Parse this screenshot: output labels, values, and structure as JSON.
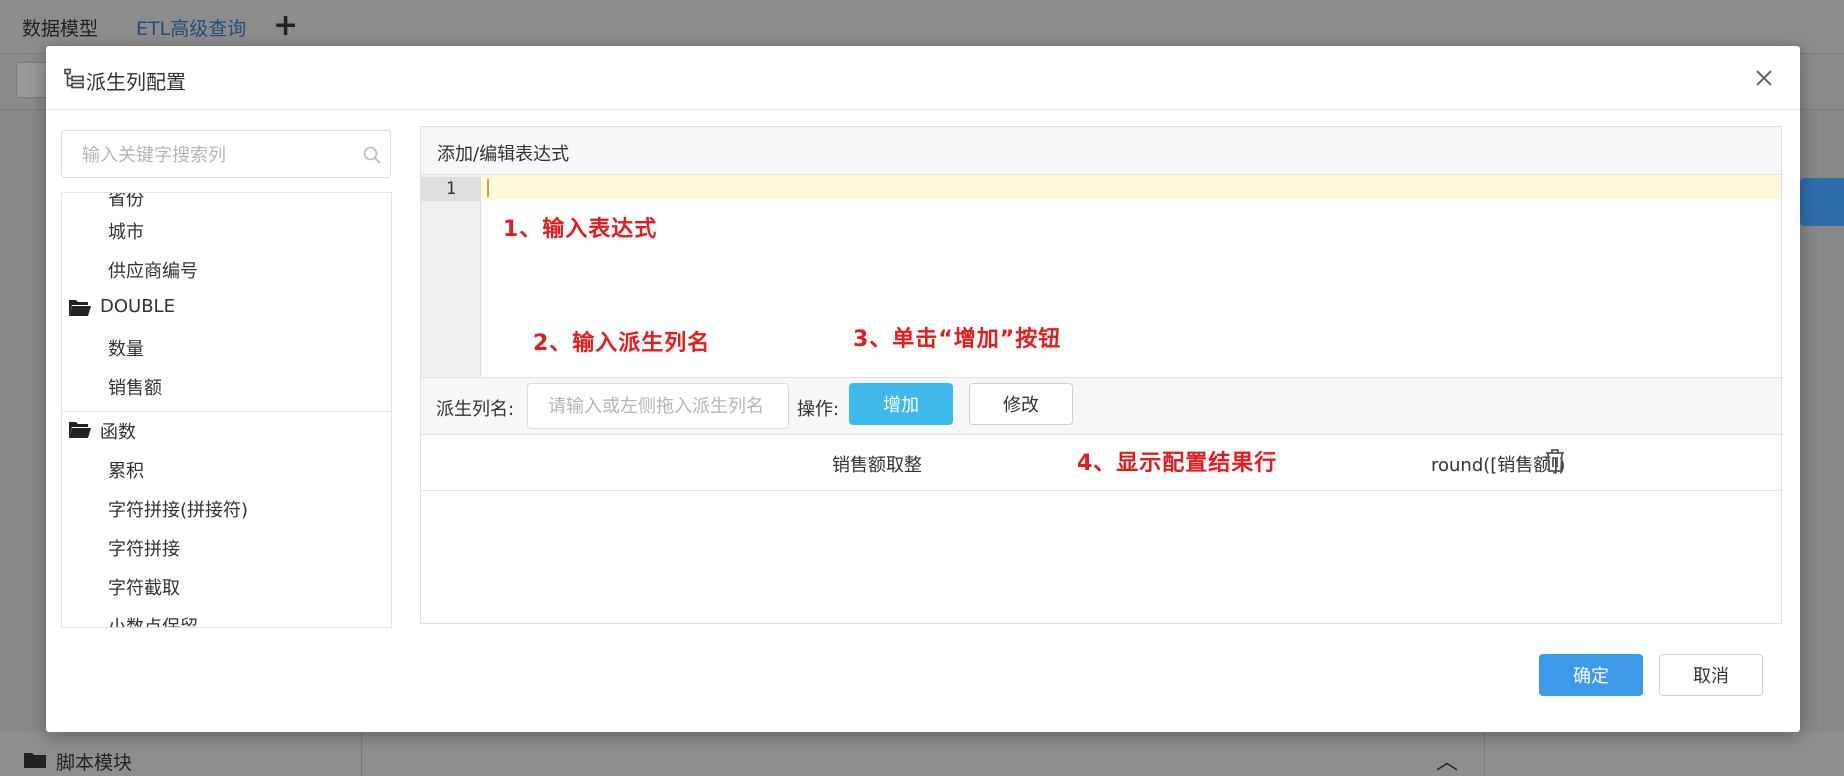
{
  "background": {
    "tabs": [
      {
        "label": "数据模型"
      },
      {
        "label": "ETL高级查询"
      }
    ],
    "add_tab_glyph": "+",
    "bottom_panel_label": "脚本模块",
    "collapse_glyph": "︿"
  },
  "dialog": {
    "title": "派生列配置",
    "title_icon": "tree-structure-icon",
    "close_icon": "close-icon"
  },
  "left_panel": {
    "search_placeholder": "输入关键字搜索列",
    "search_icon": "search-icon",
    "items": [
      {
        "type": "leaf",
        "label": "省份"
      },
      {
        "type": "leaf",
        "label": "城市"
      },
      {
        "type": "leaf",
        "label": "供应商编号"
      },
      {
        "type": "folder",
        "label": "DOUBLE"
      },
      {
        "type": "leaf",
        "label": "数量"
      },
      {
        "type": "leaf",
        "label": "销售额"
      },
      {
        "type": "folder",
        "label": "函数"
      },
      {
        "type": "leaf",
        "label": "累积"
      },
      {
        "type": "leaf",
        "label": "字符拼接(拼接符)"
      },
      {
        "type": "leaf",
        "label": "字符拼接"
      },
      {
        "type": "leaf",
        "label": "字符截取"
      },
      {
        "type": "leaf",
        "label": "小数点保留"
      }
    ]
  },
  "editor_panel": {
    "title": "添加/编辑表达式",
    "line_number": "1",
    "expression": ""
  },
  "annotations": {
    "step1": "1、输入表达式",
    "step2": "2、输入派生列名",
    "step3": "3、单击“增加”按钮",
    "step4": "4、显示配置结果行"
  },
  "form": {
    "name_label": "派生列名:",
    "name_placeholder": "请输入或左侧拖入派生列名",
    "name_value": "",
    "op_label": "操作:",
    "add_label": "增加",
    "edit_label": "修改"
  },
  "results": [
    {
      "name": "销售额取整",
      "expression": "round([销售额])",
      "delete_icon": "trash-icon"
    }
  ],
  "footer": {
    "ok_label": "确定",
    "cancel_label": "取消"
  },
  "colors": {
    "annotation_red": "#e81b1b",
    "add_button": "#3fb8ec",
    "ok_button": "#3d9ae8",
    "active_line": "#fdf9d6"
  }
}
